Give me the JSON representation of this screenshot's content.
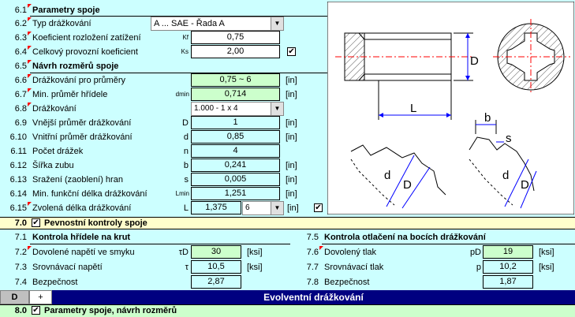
{
  "section6": {
    "rows": [
      {
        "num": "6.1",
        "label": "Parametry spoje",
        "bold": true
      },
      {
        "num": "6.2",
        "label": "Typ drážkování",
        "select": "A ... SAE  -  Řada A"
      },
      {
        "num": "6.3",
        "label": "Koeficient rozložení zatížení",
        "sym": "Kf",
        "value": "0,75"
      },
      {
        "num": "6.4",
        "label": "Celkový provozní koeficient",
        "sym": "Ks",
        "value": "2,00",
        "check": "✔"
      },
      {
        "num": "6.5",
        "label": "Návrh rozměrů spoje",
        "bold": true
      },
      {
        "num": "6.6",
        "label": "Drážkování pro průměry",
        "value": "0,75 ~ 6",
        "unit": "[in]"
      },
      {
        "num": "6.7",
        "label": "Min. průměr hřídele",
        "sym": "dmin",
        "value": "0,714",
        "unit": "[in]"
      },
      {
        "num": "6.8",
        "label": "Drážkování",
        "select": "1.000 - 1 x 4"
      },
      {
        "num": "6.9",
        "label": "Vnější průměr drážkování",
        "sym": "D",
        "value": "1",
        "unit": "[in]"
      },
      {
        "num": "6.10",
        "label": "Vnitřní průměr drážkování",
        "sym": "d",
        "value": "0,85",
        "unit": "[in]"
      },
      {
        "num": "6.11",
        "label": "Počet drážek",
        "sym": "n",
        "value": "4"
      },
      {
        "num": "6.12",
        "label": "Šířka zubu",
        "sym": "b",
        "value": "0,241",
        "unit": "[in]"
      },
      {
        "num": "6.13",
        "label": "Sražení (zaoblení) hran",
        "sym": "s",
        "value": "0,005",
        "unit": "[in]"
      },
      {
        "num": "6.14",
        "label": "Min. funkční délka drážkování",
        "sym": "Lmin",
        "value": "1,251",
        "unit": "[in]"
      },
      {
        "num": "6.15",
        "label": "Zvolená délka drážkování",
        "sym": "L",
        "value": "1,375",
        "spin": "6",
        "unit": "[in]",
        "check": "✔"
      }
    ]
  },
  "section7": {
    "num": "7.0",
    "title": "Pevnostní kontroly spoje",
    "check": "✔",
    "left": {
      "header_num": "7.1",
      "header": "Kontrola hřídele na krut",
      "rows": [
        {
          "num": "7.2",
          "label": "Dovolené napětí ve smyku",
          "sym": "τD",
          "value": "30",
          "unit": "[ksi]"
        },
        {
          "num": "7.3",
          "label": "Srovnávací napětí",
          "sym": "τ",
          "value": "10,5",
          "unit": "[ksi]"
        },
        {
          "num": "7.4",
          "label": "Bezpečnost",
          "value": "2,87"
        }
      ]
    },
    "right": {
      "header_num": "7.5",
      "header": "Kontrola otlačení na bocích drážkování",
      "rows": [
        {
          "num": "7.6",
          "label": "Dovolený tlak",
          "sym": "pD",
          "value": "19",
          "unit": "[ksi]"
        },
        {
          "num": "7.7",
          "label": "Srovnávací tlak",
          "sym": "p",
          "value": "10,2",
          "unit": "[ksi]"
        },
        {
          "num": "7.8",
          "label": "Bezpečnost",
          "value": "1,87"
        }
      ]
    }
  },
  "tabbar": {
    "tab_d": "D",
    "tab_plus": "+",
    "title": "Evolventní drážkování"
  },
  "section8": {
    "num": "8.0",
    "title": "Parametry spoje, návrh rozměrů",
    "check": "✔"
  },
  "diagram": {
    "label_D": "D",
    "label_L": "L",
    "label_b": "b",
    "label_s": "s",
    "label_d": "d"
  },
  "colors": {
    "bg": "#ccffff",
    "green": "#ccffcc",
    "yellow": "#ffffcc",
    "navy": "#000080",
    "red": "#ff0000",
    "blue": "#0000ff"
  }
}
